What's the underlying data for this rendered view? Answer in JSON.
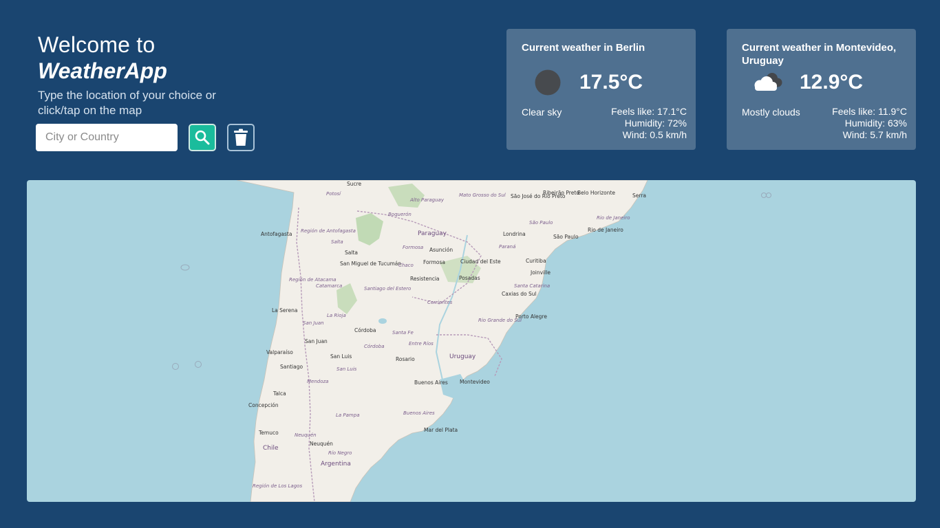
{
  "header": {
    "welcome": "Welcome to",
    "app_name": "WeatherApp",
    "subtitle": "Type the location of your choice or click/tap on the map"
  },
  "search": {
    "placeholder": "City or Country",
    "value": "",
    "search_icon": "search-icon",
    "clear_icon": "trash-icon"
  },
  "cards": [
    {
      "title": "Current weather in Berlin",
      "icon": "clear-sky-icon",
      "temperature": "17.5°C",
      "description": "Clear sky",
      "feels_like": "Feels like: 17.1°C",
      "humidity": "Humidity: 72%",
      "wind": "Wind: 0.5 km/h"
    },
    {
      "title": "Current weather in Montevideo, Uruguay",
      "icon": "clouds-icon",
      "temperature": "12.9°C",
      "description": "Mostly clouds",
      "feels_like": "Feels like: 11.9°C",
      "humidity": "Humidity: 63%",
      "wind": "Wind: 5.7 km/h"
    }
  ],
  "map": {
    "cities": [
      "Sucre",
      "São José do Rio Preto",
      "Ribeirão Preto",
      "Belo Horizonte",
      "Serra",
      "Antofagasta",
      "Londrina",
      "São Paulo",
      "Rio de Janeiro",
      "Salta",
      "Asunción",
      "Formosa",
      "Ciudad del Este",
      "San Miguel de Tucumán",
      "Resistencia",
      "Posadas",
      "Curitiba",
      "Joinville",
      "Caxias do Sul",
      "La Serena",
      "Porto Alegre",
      "Córdoba",
      "San Juan",
      "Valparaíso",
      "Santiago",
      "San Luis",
      "Rosario",
      "Buenos Aires",
      "Montevideo",
      "Talca",
      "Concepción",
      "Mar del Plata",
      "Temuco",
      "Neuquén"
    ],
    "regions": [
      "Potosí",
      "Mato Grosso do Sul",
      "Alto Paraguay",
      "Boquerón",
      "Región de Antofagasta",
      "Salta",
      "Paraná",
      "São Paulo",
      "Rio de Janeiro",
      "Formosa",
      "Chaco",
      "Región de Atacama",
      "Catamarca",
      "Santiago del Estero",
      "Santa Catarina",
      "Corrientes",
      "Rio Grande do Sul",
      "La Rioja",
      "San Juan",
      "Santa Fe",
      "Entre Ríos",
      "Córdoba",
      "San Luis",
      "Mendoza",
      "Buenos Aires",
      "La Pampa",
      "Neuquén",
      "Río Negro",
      "Región de Los Lagos"
    ],
    "countries": [
      "Paraguay",
      "Uruguay",
      "Chile",
      "Argentina"
    ]
  }
}
